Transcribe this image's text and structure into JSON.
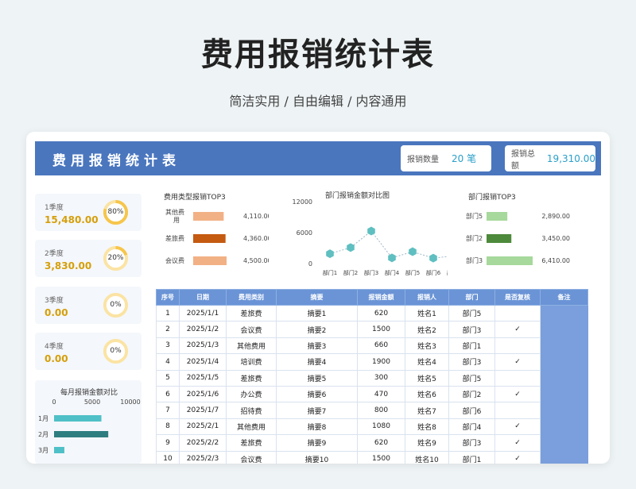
{
  "hero": {
    "title": "费用报销统计表",
    "subtitle": "简洁实用 / 自由编辑 / 内容通用"
  },
  "banner": {
    "title": "费用报销统计表",
    "count_label": "报销数量",
    "count_value": "20 笔",
    "total_label": "报销总额",
    "total_value": "19,310.00"
  },
  "quarters": [
    {
      "label": "1季度",
      "value": "15,480.00",
      "percent": "80%",
      "fraction": 0.8
    },
    {
      "label": "2季度",
      "value": "3,830.00",
      "percent": "20%",
      "fraction": 0.2
    },
    {
      "label": "3季度",
      "value": "0.00",
      "percent": "0%",
      "fraction": 0
    },
    {
      "label": "4季度",
      "value": "0.00",
      "percent": "0%",
      "fraction": 0
    }
  ],
  "monthly": {
    "title": "每月报销金额对比",
    "ticks": [
      "0",
      "5000",
      "10000"
    ],
    "max": 10000,
    "rows": [
      {
        "label": "1月",
        "value": 6200
      },
      {
        "label": "2月",
        "value": 7100
      },
      {
        "label": "3月",
        "value": 1350
      }
    ]
  },
  "type_top3": {
    "title": "费用类型报销TOP3",
    "max": 4500,
    "items": [
      {
        "label": "其他费用",
        "value": "4,110.00",
        "amount": 4110
      },
      {
        "label": "差旅费",
        "value": "4,360.00",
        "amount": 4360
      },
      {
        "label": "会议费",
        "value": "4,500.00",
        "amount": 4500
      }
    ]
  },
  "chart_data": {
    "type": "line",
    "title": "部门报销金额对比图",
    "categories": [
      "部门1",
      "部门2",
      "部门3",
      "部门4",
      "部门5",
      "部门6",
      "部门7"
    ],
    "values": [
      1900,
      3100,
      6300,
      1100,
      2300,
      1050,
      1500
    ],
    "y_ticks": [
      "12000",
      "6000",
      "0"
    ],
    "ylim": [
      0,
      12000
    ],
    "color": "#5fbfc1"
  },
  "dept_top3": {
    "title": "部门报销TOP3",
    "max": 6410,
    "items": [
      {
        "label": "部门5",
        "value": "2,890.00",
        "amount": 2890,
        "color": "#a6d99b"
      },
      {
        "label": "部门2",
        "value": "3,450.00",
        "amount": 3450,
        "color": "#4d8a3b"
      },
      {
        "label": "部门3",
        "value": "6,410.00",
        "amount": 6410,
        "color": "#a6d99b"
      }
    ]
  },
  "table": {
    "headers": [
      "序号",
      "日期",
      "费用类别",
      "摘要",
      "报销金额",
      "报销人",
      "部门",
      "是否复核",
      "备注"
    ],
    "rows": [
      [
        "1",
        "2025/1/1",
        "差旅费",
        "摘要1",
        "620",
        "姓名1",
        "部门5",
        "",
        ""
      ],
      [
        "2",
        "2025/1/2",
        "会议费",
        "摘要2",
        "1500",
        "姓名2",
        "部门3",
        "✓",
        ""
      ],
      [
        "3",
        "2025/1/3",
        "其他费用",
        "摘要3",
        "660",
        "姓名3",
        "部门1",
        "",
        ""
      ],
      [
        "4",
        "2025/1/4",
        "培训费",
        "摘要4",
        "1900",
        "姓名4",
        "部门3",
        "✓",
        ""
      ],
      [
        "5",
        "2025/1/5",
        "差旅费",
        "摘要5",
        "300",
        "姓名5",
        "部门5",
        "",
        ""
      ],
      [
        "6",
        "2025/1/6",
        "办公费",
        "摘要6",
        "470",
        "姓名6",
        "部门2",
        "✓",
        ""
      ],
      [
        "7",
        "2025/1/7",
        "招待费",
        "摘要7",
        "800",
        "姓名7",
        "部门6",
        "",
        ""
      ],
      [
        "8",
        "2025/2/1",
        "其他费用",
        "摘要8",
        "1080",
        "姓名8",
        "部门4",
        "✓",
        ""
      ],
      [
        "9",
        "2025/2/2",
        "差旅费",
        "摘要9",
        "620",
        "姓名9",
        "部门3",
        "✓",
        ""
      ],
      [
        "10",
        "2025/2/3",
        "会议费",
        "摘要10",
        "1500",
        "姓名10",
        "部门1",
        "✓",
        ""
      ]
    ]
  }
}
